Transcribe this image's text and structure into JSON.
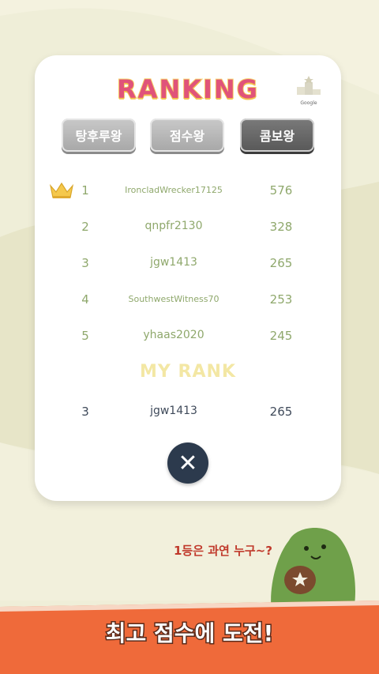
{
  "title": "RANKING",
  "leaderboard_icon_label": "Google",
  "tabs": [
    {
      "label": "탕후루왕"
    },
    {
      "label": "점수왕"
    },
    {
      "label": "콤보왕"
    }
  ],
  "active_tab": "콤보왕",
  "rankings": [
    {
      "rank": "1",
      "name": "IroncladWrecker17125",
      "score": "576"
    },
    {
      "rank": "2",
      "name": "qnpfr2130",
      "score": "328"
    },
    {
      "rank": "3",
      "name": "jgw1413",
      "score": "265"
    },
    {
      "rank": "4",
      "name": "SouthwestWitness70",
      "score": "253"
    },
    {
      "rank": "5",
      "name": "yhaas2020",
      "score": "245"
    }
  ],
  "my_rank_title": "MY RANK",
  "my_rank": {
    "rank": "3",
    "name": "jgw1413",
    "score": "265"
  },
  "close_symbol": "✕",
  "bubble_text": "1등은 과연 누구~?",
  "footer_text": "최고 점수에 도전!",
  "colors": {
    "title": "#e0537a",
    "row_text": "#8fa86c",
    "my_row_text": "#3f4a5a",
    "close_button": "#2c3a4d",
    "banner": "#ef6a3a"
  }
}
